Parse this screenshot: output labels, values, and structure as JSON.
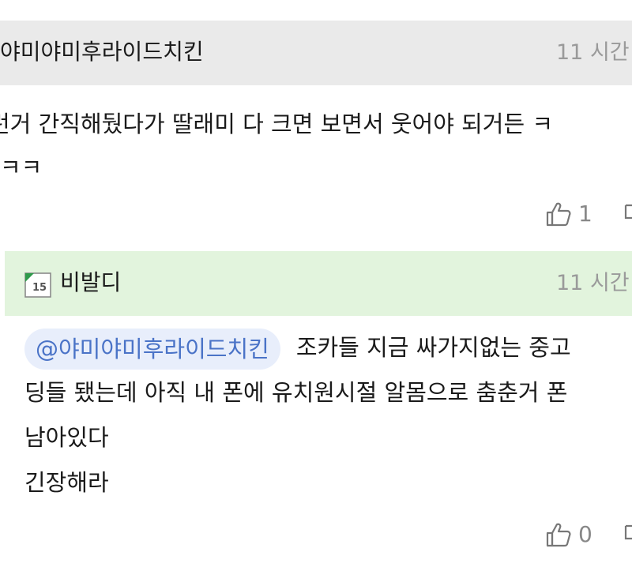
{
  "comment": {
    "author": "야미야미후라이드치킨",
    "time": "11 시간",
    "body_lines": [
      "런거 간직해뒀다가 딸래미 다 크면 보면서 웃어야 되거든 ㅋ",
      "ㅋㅋ"
    ],
    "likes": "1"
  },
  "reply": {
    "author": "비발디",
    "badge": "15",
    "time": "11 시간",
    "mention": "@야미야미후라이드치킨",
    "body_lines": [
      "조카들 지금 싸가지없는 중고",
      "딩들 됐는데 아직 내 폰에 유치원시절 알몸으로 춤춘거 폰",
      "남아있다",
      "긴장해라"
    ],
    "likes": "0"
  },
  "colors": {
    "header_gray": "#eaeaea",
    "reply_header_green": "#e2f4dd",
    "mention_bg": "#e8eefb",
    "mention_text": "#4a73c7",
    "muted_text": "#9a9a9a"
  }
}
